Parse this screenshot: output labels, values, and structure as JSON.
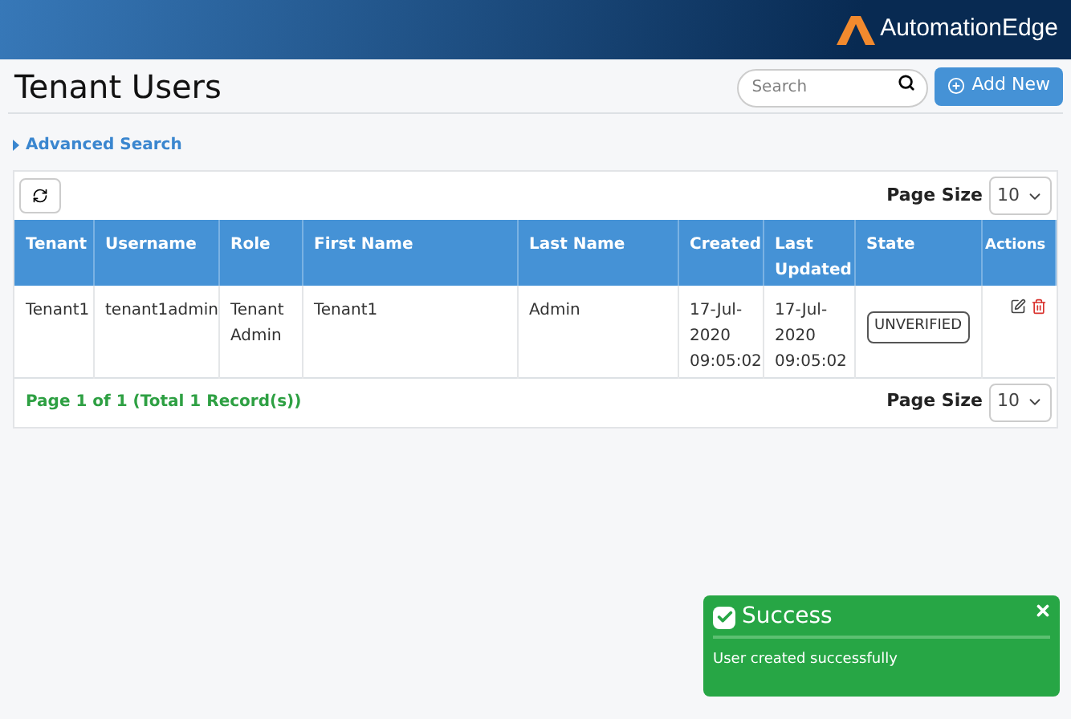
{
  "header": {
    "logo_text": "AutomationEdge"
  },
  "page": {
    "title": "Tenant Users",
    "search": {
      "placeholder": "Search"
    },
    "add_button": "Add New"
  },
  "advanced_search": {
    "label": "Advanced Search",
    "expanded": false
  },
  "toolbar": {
    "page_size_label": "Page Size",
    "page_size": "10"
  },
  "table": {
    "columns": [
      "Tenant",
      "Username",
      "Role",
      "First Name",
      "Last Name",
      "Created",
      "Last Updated",
      "State",
      "Actions"
    ],
    "rows": [
      {
        "cells": [
          "Tenant1",
          "tenant1admin",
          "Tenant Admin",
          "Tenant1",
          "Admin",
          "17-Jul-2020 09:05:02",
          "17-Jul-2020 09:05:02"
        ],
        "state": "UNVERIFIED"
      }
    ]
  },
  "footer": {
    "summary": "Page 1 of 1 (Total 1 Record(s))",
    "page_size_label": "Page Size",
    "page_size": "10"
  },
  "toast": {
    "title": "Success",
    "message": "User created successfully"
  }
}
